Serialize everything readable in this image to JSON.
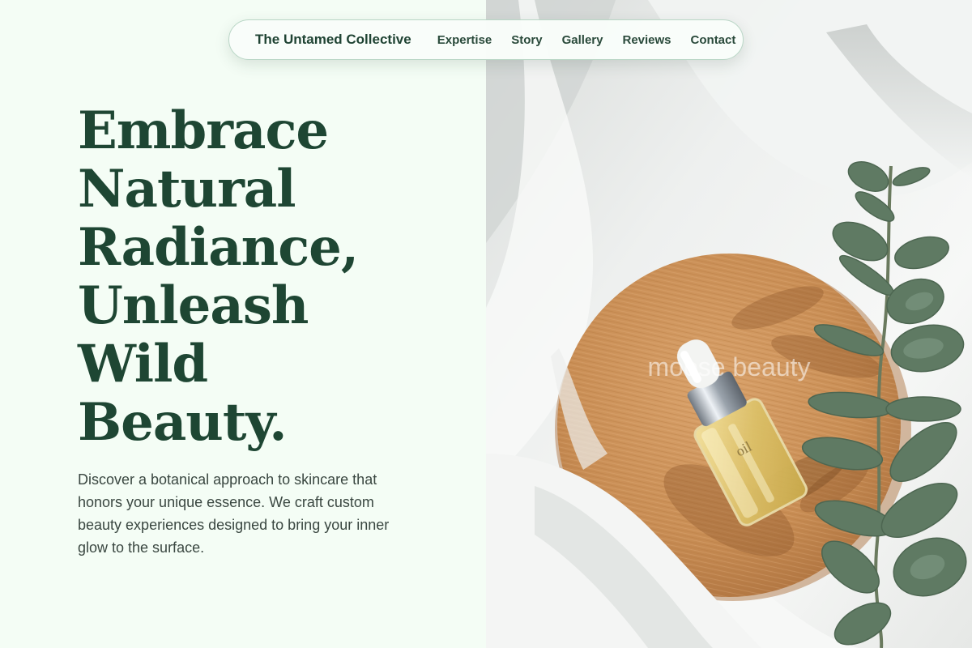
{
  "nav": {
    "brand": "The Untamed Collective",
    "links": [
      {
        "label": "Expertise"
      },
      {
        "label": "Story"
      },
      {
        "label": "Gallery"
      },
      {
        "label": "Reviews"
      },
      {
        "label": "Contact"
      }
    ]
  },
  "hero": {
    "title_lines": [
      "Embrace",
      "Natural",
      "Radiance,",
      "Unleash",
      "Wild",
      "Beauty."
    ],
    "description": "Discover a botanical approach to skincare that honors your unique essence. We craft custom beauty experiences designed to bring your inner glow to the surface."
  },
  "image": {
    "watermark": "moose beauty",
    "bottle_label": "oil"
  },
  "colors": {
    "page_bg": "#f4fdf5",
    "heading": "#1e4633",
    "nav_text": "#2a4a3b",
    "body_text": "#3a4741",
    "nav_border": "#b9d6c6"
  }
}
